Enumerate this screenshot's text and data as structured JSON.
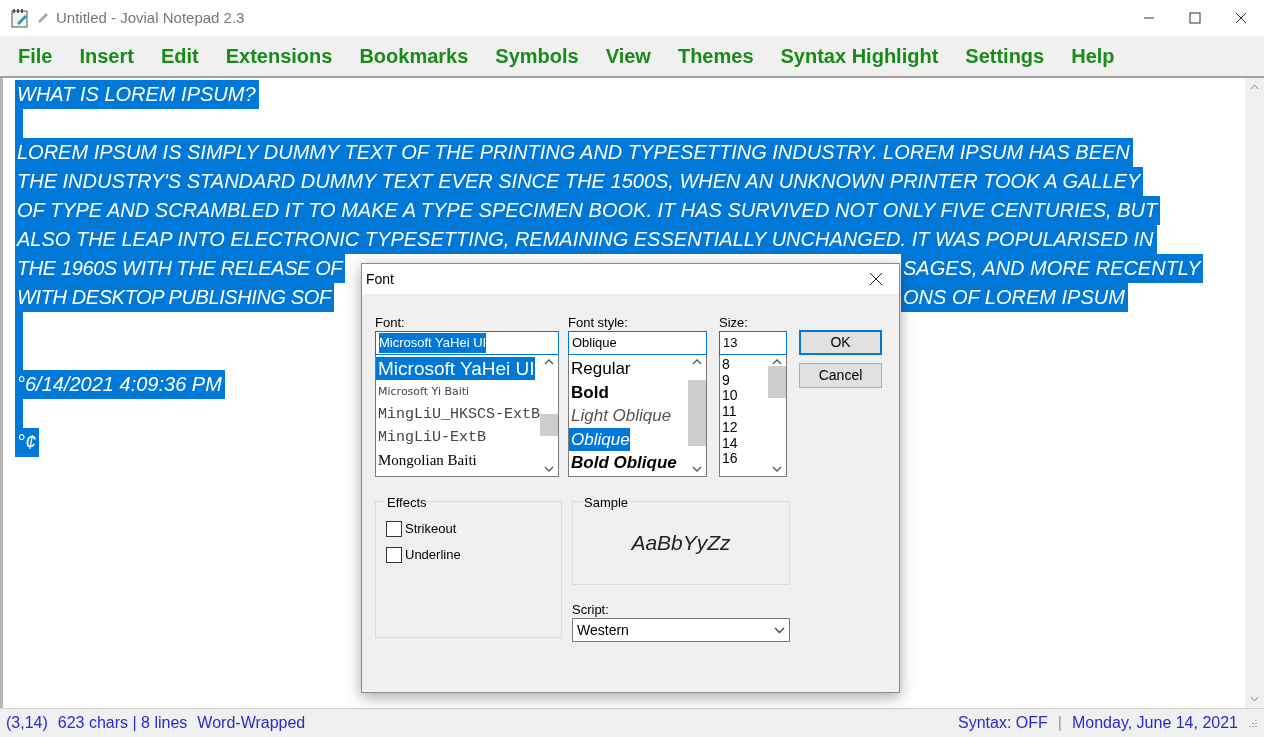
{
  "window": {
    "title": "Untitled - Jovial Notepad 2.3"
  },
  "menu": [
    "File",
    "Insert",
    "Edit",
    "Extensions",
    "Bookmarks",
    "Symbols",
    "View",
    "Themes",
    "Syntax Highlight",
    "Settings",
    "Help"
  ],
  "editor": {
    "all_selected": true,
    "lines": [
      {
        "kind": "text",
        "text": "WHAT IS LOREM IPSUM?"
      },
      {
        "kind": "blank"
      },
      {
        "kind": "text",
        "text": "LOREM IPSUM IS SIMPLY DUMMY TEXT OF THE PRINTING AND TYPESETTING INDUSTRY. LOREM IPSUM HAS BEEN"
      },
      {
        "kind": "text",
        "text": "THE INDUSTRY'S STANDARD DUMMY TEXT EVER SINCE THE 1500S, WHEN AN UNKNOWN PRINTER TOOK A GALLEY"
      },
      {
        "kind": "text",
        "text": "OF TYPE AND SCRAMBLED IT TO MAKE A TYPE SPECIMEN BOOK. IT HAS SURVIVED NOT ONLY FIVE CENTURIES, BUT"
      },
      {
        "kind": "text",
        "text": "ALSO THE LEAP INTO ELECTRONIC TYPESETTING, REMAINING ESSENTIALLY UNCHANGED. IT WAS POPULARISED IN"
      },
      {
        "kind": "split",
        "parts": [
          "THE 1960S WITH THE RELEASE OF",
          "SAGES, AND MORE RECENTLY"
        ]
      },
      {
        "kind": "split",
        "parts": [
          "WITH DESKTOP PUBLISHING SOF",
          "ONS OF LOREM IPSUM"
        ]
      },
      {
        "kind": "blank"
      },
      {
        "kind": "blank"
      },
      {
        "kind": "text",
        "text": "°6/14/2021 4:09:36 PM"
      },
      {
        "kind": "blank"
      },
      {
        "kind": "text",
        "text": "°¢"
      }
    ]
  },
  "dialog": {
    "title": "Font",
    "font": {
      "label": "Font:",
      "value": "Microsoft YaHei UI",
      "items": [
        {
          "text": "Microsoft YaHei UI",
          "kind": "large",
          "selected": true
        },
        {
          "text": "Microsoft Yi Baiti",
          "kind": "small",
          "selected": false
        },
        {
          "text": "MingLiU_HKSCS-ExtB",
          "kind": "serif",
          "selected": false
        },
        {
          "text": "MingLiU-ExtB",
          "kind": "serif",
          "selected": false
        },
        {
          "text": "Mongolian Baiti",
          "kind": "roman",
          "selected": false
        }
      ]
    },
    "style": {
      "label": "Font style:",
      "value": "Oblique",
      "items": [
        {
          "text": "Regular",
          "kind": "regular",
          "selected": false
        },
        {
          "text": "Bold",
          "kind": "bold",
          "selected": false
        },
        {
          "text": "Light Oblique",
          "kind": "light-italic",
          "selected": false
        },
        {
          "text": "Oblique",
          "kind": "italic",
          "selected": true
        },
        {
          "text": "Bold Oblique",
          "kind": "bold-italic",
          "selected": false
        }
      ]
    },
    "size": {
      "label": "Size:",
      "value": "13",
      "items": [
        {
          "text": "8",
          "selected": false
        },
        {
          "text": "9",
          "selected": false
        },
        {
          "text": "10",
          "selected": false
        },
        {
          "text": "11",
          "selected": false
        },
        {
          "text": "12",
          "selected": false
        },
        {
          "text": "14",
          "selected": false
        },
        {
          "text": "16",
          "selected": false
        }
      ]
    },
    "buttons": [
      {
        "label": "OK",
        "default": true
      },
      {
        "label": "Cancel",
        "default": false
      }
    ],
    "effects": {
      "title": "Effects",
      "options": [
        {
          "label": "Strikeout",
          "checked": false
        },
        {
          "label": "Underline",
          "checked": false
        }
      ]
    },
    "sample": {
      "title": "Sample",
      "text": "AaBbYyZz"
    },
    "script": {
      "label": "Script:",
      "value": "Western"
    }
  },
  "status_bar": {
    "left": [
      "(3,14)",
      "623 chars | 8 lines",
      "Word-Wrapped"
    ],
    "right": [
      "Syntax: OFF",
      "|",
      "Monday, June 14, 2021"
    ]
  }
}
